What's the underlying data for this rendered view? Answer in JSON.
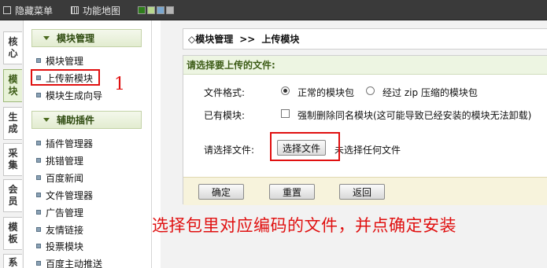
{
  "topbar": {
    "hide_menu": "隐藏菜单",
    "function_map": "功能地图",
    "swatches": [
      "#2f7d1c",
      "#b7d88f",
      "#7aa7cf",
      "#b5b5b5"
    ]
  },
  "vertical_tabs": [
    {
      "label": "核\n心",
      "active": false
    },
    {
      "label": "模\n块",
      "active": true
    },
    {
      "label": "生\n成",
      "active": false
    },
    {
      "label": "采\n集",
      "active": false
    },
    {
      "label": "会\n员",
      "active": false
    },
    {
      "label": "模\n板",
      "active": false
    },
    {
      "label": "系",
      "active": false
    }
  ],
  "sidebar": {
    "group1_title": "模块管理",
    "group1_items": [
      "模块管理",
      "上传新模块",
      "模块生成向导"
    ],
    "group2_title": "辅助插件",
    "group2_items": [
      "插件管理器",
      "挑错管理",
      "百度新闻",
      "文件管理器",
      "广告管理",
      "友情链接",
      "投票模块",
      "百度主动推送"
    ]
  },
  "breadcrumb": {
    "root": "◇模块管理",
    "separator": ">>",
    "current": "上传模块"
  },
  "form": {
    "header": "请选择要上传的文件:",
    "format_label": "文件格式:",
    "format_option1": "正常的模块包",
    "format_option2": "经过 zip 压缩的模块包",
    "existing_label": "已有模块:",
    "existing_option": "强制删除同名模块(这可能导致已经安装的模块无法卸载)",
    "file_label": "请选择文件:",
    "file_button": "选择文件",
    "file_status": "未选择任何文件",
    "confirm": "确定",
    "reset": "重置",
    "back": "返回"
  },
  "annotations": {
    "step_number": "1",
    "instruction": "选择包里对应编码的文件，并点确定安装",
    "color": "#e01010"
  }
}
